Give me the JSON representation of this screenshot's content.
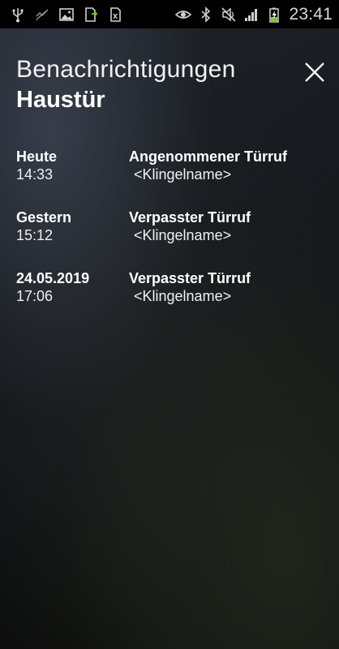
{
  "status_bar": {
    "left_icons": [
      "usb-icon",
      "sync-off-icon",
      "image-icon",
      "download-icon",
      "sd-card-icon"
    ],
    "right_icons": [
      "eye-icon",
      "bluetooth-icon",
      "silent-icon",
      "signal-icon",
      "battery-charging-icon"
    ],
    "time": "23:41"
  },
  "header": {
    "title": "Benachrichtigungen",
    "subtitle": "Haustür",
    "close_icon": "close-icon"
  },
  "notifications": [
    {
      "date": "Heute",
      "time": "14:33",
      "type": "Angenommener Türruf",
      "name": "<Klingelname>"
    },
    {
      "date": "Gestern",
      "time": "15:12",
      "type": "Verpasster Türruf",
      "name": "<Klingelname>"
    },
    {
      "date": "24.05.2019",
      "time": "17:06",
      "type": "Verpasster Türruf",
      "name": "<Klingelname>"
    }
  ],
  "colors": {
    "text": "#ffffff",
    "status_bar_bg": "#000000",
    "battery_charge": "#7cc832"
  }
}
